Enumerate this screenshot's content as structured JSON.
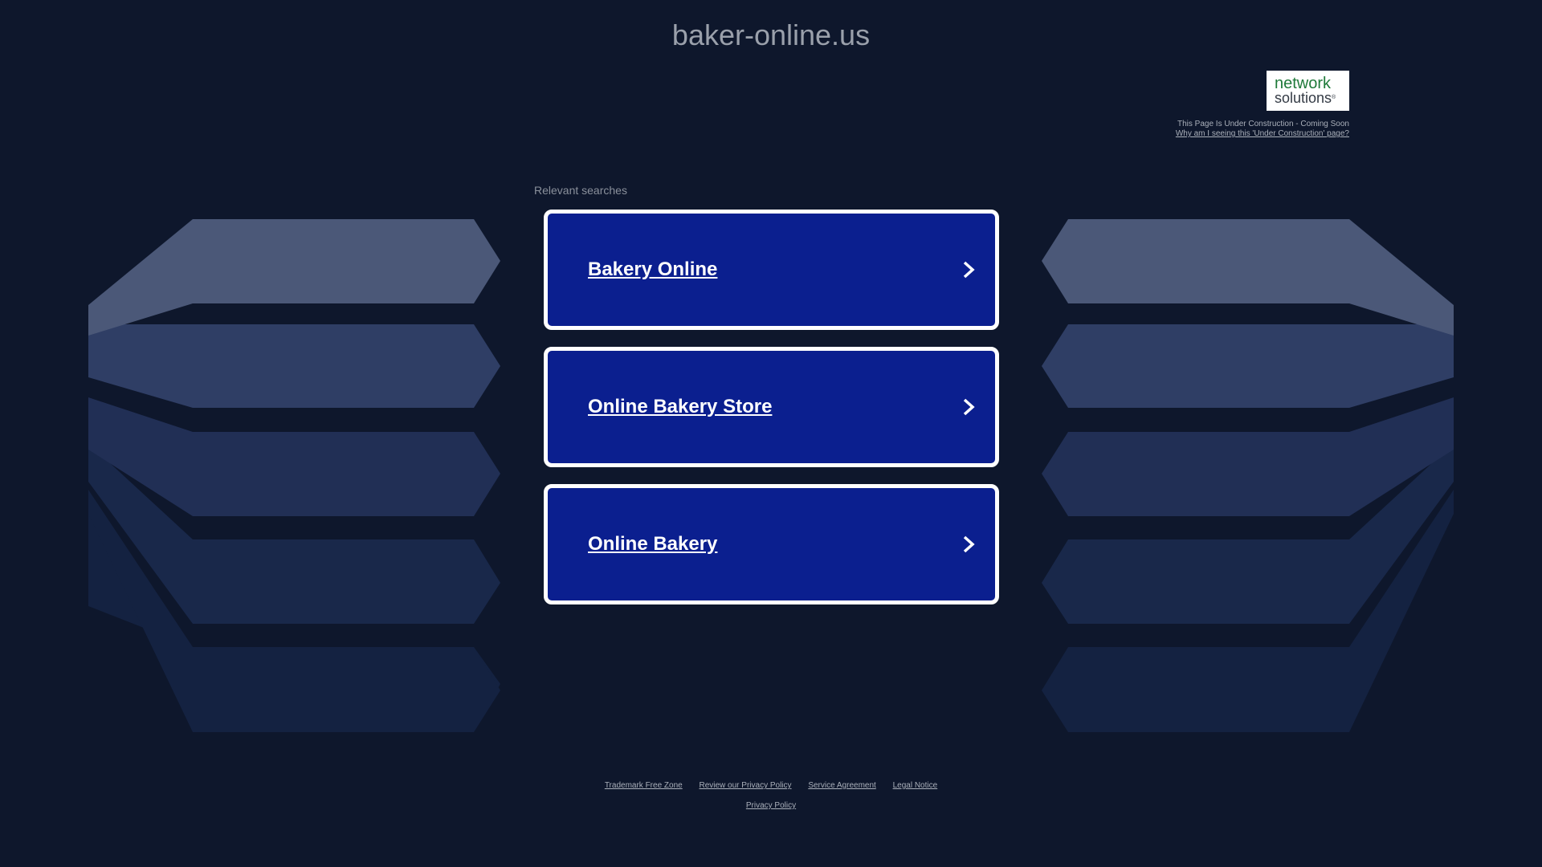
{
  "page": {
    "domain": "baker-online.us"
  },
  "logo": {
    "line1": "network",
    "line2": "solutions",
    "mark": "®"
  },
  "under_construction": {
    "status_text": "This Page Is Under Construction - Coming Soon",
    "why_link": "Why am I seeing this 'Under Construction' page?"
  },
  "searches": {
    "heading": "Relevant searches",
    "items": [
      {
        "label": "Bakery Online",
        "icon": "chevron-right-icon"
      },
      {
        "label": "Online Bakery Store",
        "icon": "chevron-right-icon"
      },
      {
        "label": "Online Bakery",
        "icon": "chevron-right-icon"
      }
    ]
  },
  "footer": {
    "links": [
      "Trademark Free Zone",
      "Review our Privacy Policy",
      "Service Agreement",
      "Legal Notice"
    ],
    "privacy": "Privacy Policy"
  },
  "colors": {
    "background": "#0e172c",
    "button": "#0b1f8f",
    "button_border": "#ffffff",
    "logo_green": "#1f7a3a"
  }
}
